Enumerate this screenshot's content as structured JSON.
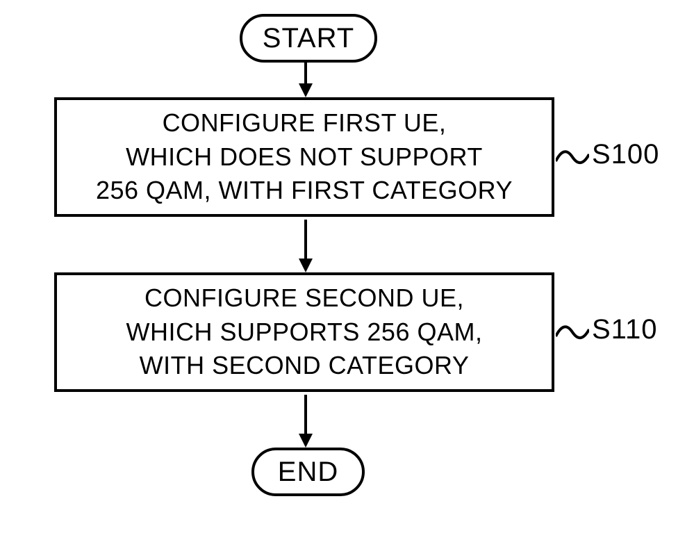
{
  "flow": {
    "start_label": "START",
    "end_label": "END",
    "step1": {
      "text": "CONFIGURE FIRST UE,\nWHICH DOES NOT SUPPORT\n256 QAM, WITH FIRST CATEGORY",
      "id": "S100"
    },
    "step2": {
      "text": "CONFIGURE SECOND UE,\nWHICH SUPPORTS 256 QAM,\nWITH SECOND CATEGORY",
      "id": "S110"
    }
  }
}
